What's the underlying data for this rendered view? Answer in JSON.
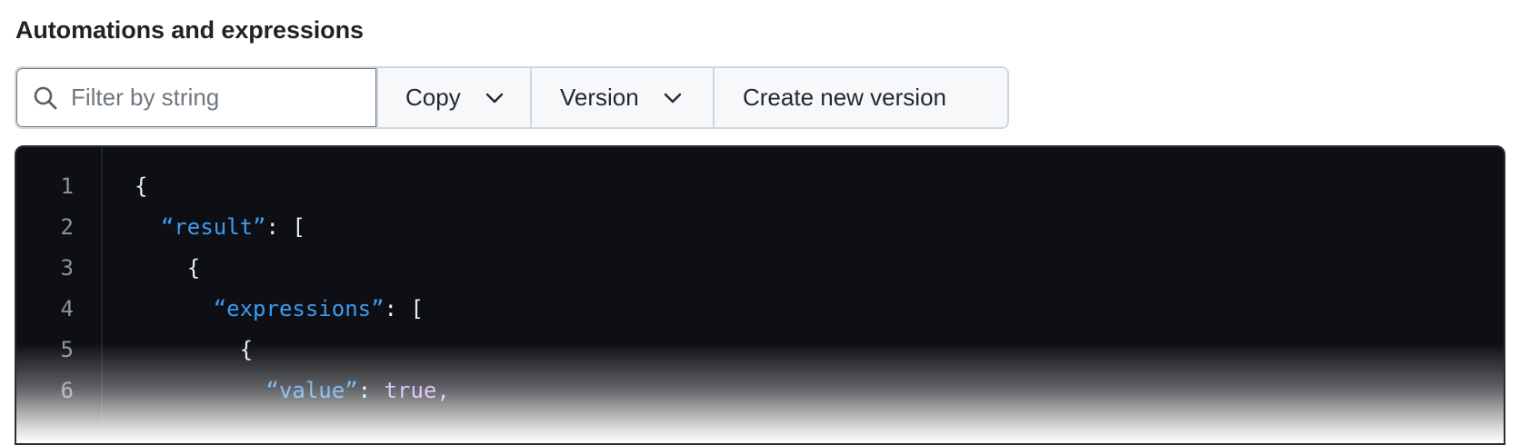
{
  "header": {
    "title": "Automations and expressions"
  },
  "toolbar": {
    "search": {
      "placeholder": "Filter by string",
      "value": "",
      "icon": "search-icon"
    },
    "copy_label": "Copy",
    "version_label": "Version",
    "create_label": "Create new version",
    "dropdown_icon": "chevron-down-icon"
  },
  "code": {
    "lines": [
      {
        "num": "1",
        "indent": "",
        "key": "",
        "rest": "{"
      },
      {
        "num": "2",
        "indent": "  ",
        "key": "“result”",
        "rest": ": ["
      },
      {
        "num": "3",
        "indent": "    ",
        "key": "",
        "rest": "{"
      },
      {
        "num": "4",
        "indent": "      ",
        "key": "“expressions”",
        "rest": ": ["
      },
      {
        "num": "5",
        "indent": "        ",
        "key": "",
        "rest": "{"
      },
      {
        "num": "6",
        "indent": "          ",
        "key": "“value”",
        "rest": ": ",
        "val": "true,"
      }
    ]
  },
  "colors": {
    "code_background": "#0d0f14",
    "json_key": "#3d9bf0",
    "json_boolean": "#c7a4f5",
    "line_number": "#8b929b"
  }
}
